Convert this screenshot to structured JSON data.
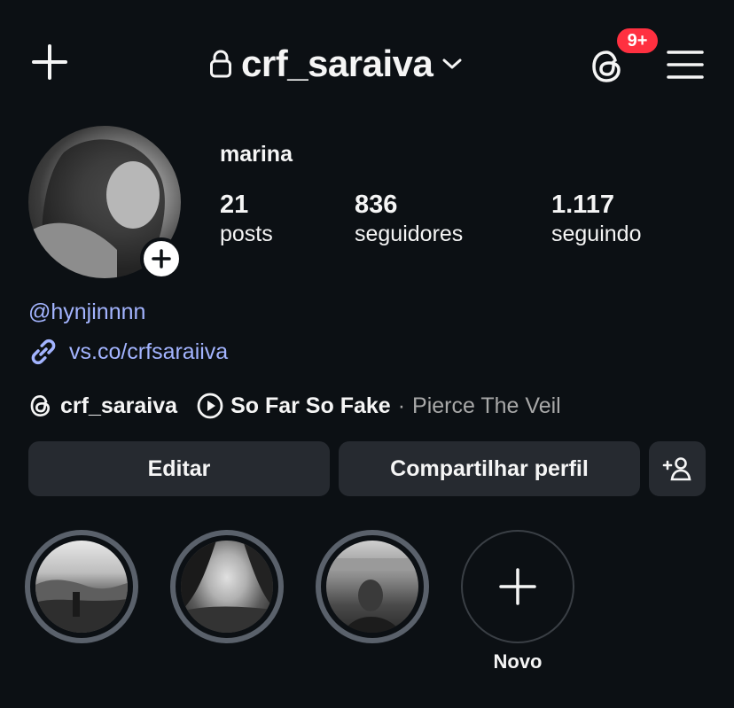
{
  "header": {
    "username": "crf_saraiva",
    "notification_badge": "9+",
    "icons": [
      "plus-icon",
      "lock-icon",
      "chevron-down-icon",
      "threads-icon",
      "hamburger-menu-icon"
    ]
  },
  "profile": {
    "display_name": "marina",
    "stats": {
      "posts": {
        "count": "21",
        "label": "posts"
      },
      "followers": {
        "count": "836",
        "label": "seguidores"
      },
      "following": {
        "count": "1.117",
        "label": "seguindo"
      }
    },
    "mention": "@hynjinnnn",
    "link": "vs.co/crfsaraiiva",
    "threads_username": "crf_saraiva",
    "music": {
      "title": "So Far So Fake",
      "separator": "·",
      "artist": "Pierce The Veil"
    }
  },
  "actions": {
    "edit_label": "Editar",
    "share_label": "Compartilhar perfil"
  },
  "highlights": {
    "new_label": "Novo"
  },
  "colors": {
    "background": "#0c1014",
    "link": "#a3b4ff",
    "badge": "#ff3040",
    "button": "#262a30",
    "secondary_text": "#a8a8a8"
  }
}
